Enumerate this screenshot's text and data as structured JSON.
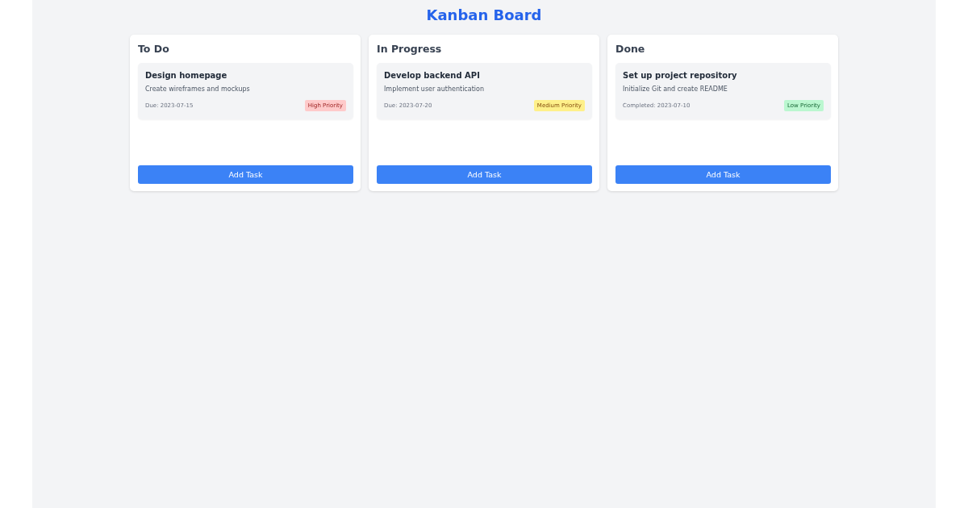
{
  "title": "Kanban Board",
  "columns": [
    {
      "title": "To Do",
      "tasks": [
        {
          "title": "Design homepage",
          "description": "Create wireframes and mockups",
          "date": "Due: 2023-07-15",
          "priority": {
            "kind": "high",
            "label": "High Priority"
          }
        }
      ],
      "button": "Add Task"
    },
    {
      "title": "In Progress",
      "tasks": [
        {
          "title": "Develop backend API",
          "description": "Implement user authentication",
          "date": "Due: 2023-07-20",
          "priority": {
            "kind": "medium",
            "label": "Medium Priority"
          }
        }
      ],
      "button": "Add Task"
    },
    {
      "title": "Done",
      "tasks": [
        {
          "title": "Set up project repository",
          "description": "Initialize Git and create README",
          "date": "Completed: 2023-07-10",
          "priority": {
            "kind": "low",
            "label": "Low Priority"
          }
        }
      ],
      "button": "Add Task"
    }
  ]
}
